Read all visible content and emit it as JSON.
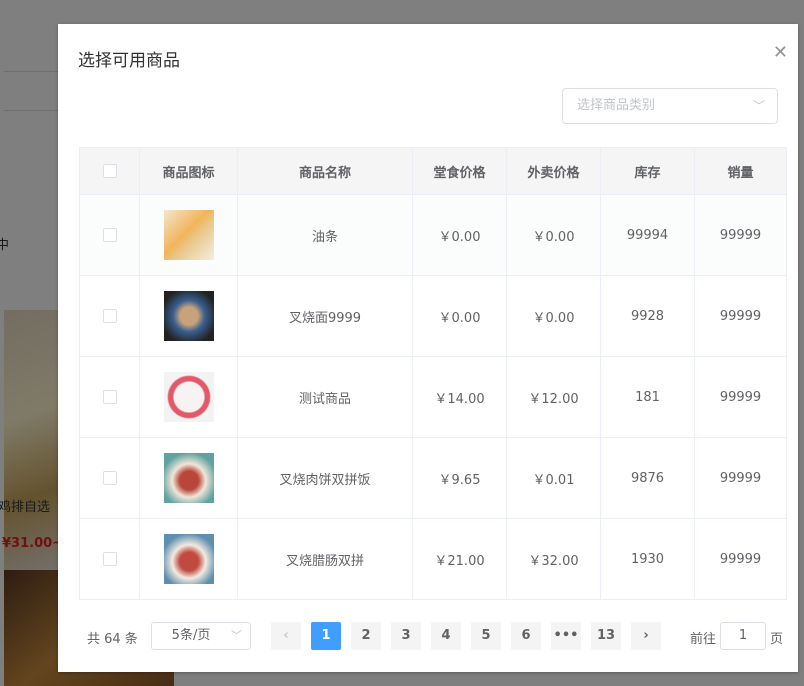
{
  "background": {
    "text_partial_1": "中",
    "text_partial_2": "鸡排自选",
    "price_partial": "¥31.00~"
  },
  "dialog": {
    "title": "选择可用商品",
    "close_icon": "close-icon"
  },
  "category_select": {
    "placeholder": "选择商品类别"
  },
  "table": {
    "headers": [
      "商品图标",
      "商品名称",
      "堂食价格",
      "外卖价格",
      "库存",
      "销量"
    ],
    "rows": [
      {
        "name": "油条",
        "dine_in": "￥0.00",
        "takeout": "￥0.00",
        "stock": "99994",
        "sales": "99999"
      },
      {
        "name": "叉烧面9999",
        "dine_in": "￥0.00",
        "takeout": "￥0.00",
        "stock": "9928",
        "sales": "99999"
      },
      {
        "name": "测试商品",
        "dine_in": "￥14.00",
        "takeout": "￥12.00",
        "stock": "181",
        "sales": "99999"
      },
      {
        "name": "叉烧肉饼双拼饭",
        "dine_in": "￥9.65",
        "takeout": "￥0.01",
        "stock": "9876",
        "sales": "99999"
      },
      {
        "name": "叉烧腊肠双拼",
        "dine_in": "￥21.00",
        "takeout": "￥32.00",
        "stock": "1930",
        "sales": "99999"
      }
    ]
  },
  "pagination": {
    "total": "共 64 条",
    "page_size": "5条/页",
    "pages": [
      "1",
      "2",
      "3",
      "4",
      "5",
      "6",
      "•••",
      "13"
    ],
    "current": "1",
    "goto_label": "前往",
    "goto_value": "1",
    "goto_unit": "页",
    "accent": "#409eff"
  }
}
